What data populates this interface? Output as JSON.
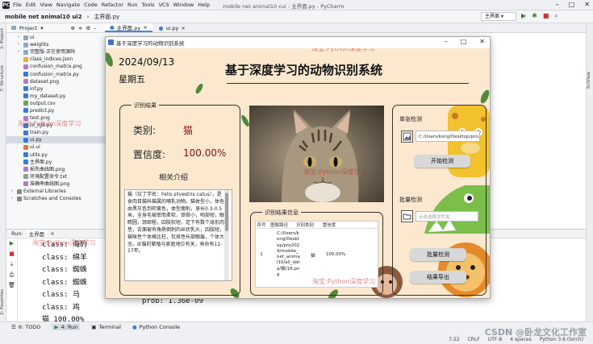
{
  "ide": {
    "menu": [
      "File",
      "Edit",
      "View",
      "Navigate",
      "Code",
      "Refactor",
      "Run",
      "Tools",
      "VCS",
      "Window",
      "Help"
    ],
    "window_title": "mobile net animal10 cui - 主界面.py - PyCharm",
    "breadcrumb": [
      "mobile net animal10 ui2",
      "主界面.py"
    ],
    "run_config": "主界面",
    "project_header": "Project",
    "tree": [
      {
        "label": "ui",
        "type": "folder",
        "indent": 1
      },
      {
        "label": "weights",
        "type": "folder",
        "indent": 1
      },
      {
        "label": "完整版-正在使用源码",
        "type": "folder",
        "indent": 1
      },
      {
        "label": "class_indices.json",
        "type": "json",
        "indent": 1
      },
      {
        "label": "confusion_matrix.png",
        "type": "img",
        "indent": 1
      },
      {
        "label": "confusion_matrix.py",
        "type": "py",
        "indent": 1
      },
      {
        "label": "dataset.png",
        "type": "img",
        "indent": 1
      },
      {
        "label": "inf.py",
        "type": "py",
        "indent": 1
      },
      {
        "label": "my_dataset.py",
        "type": "py",
        "indent": 1
      },
      {
        "label": "output.csv",
        "type": "csv",
        "indent": 1
      },
      {
        "label": "predict.py",
        "type": "py",
        "indent": 1
      },
      {
        "label": "test.png",
        "type": "img",
        "indent": 1
      },
      {
        "label": "to_rgb.py",
        "type": "py",
        "indent": 1
      },
      {
        "label": "train.py",
        "type": "py",
        "indent": 1
      },
      {
        "label": "ui.py",
        "type": "py",
        "indent": 1,
        "selected": true
      },
      {
        "label": "ui.ui",
        "type": "ui",
        "indent": 1
      },
      {
        "label": "utils.py",
        "type": "py",
        "indent": 1
      },
      {
        "label": "主界面.py",
        "type": "py",
        "indent": 1
      },
      {
        "label": "损失曲线图.png",
        "type": "img",
        "indent": 1
      },
      {
        "label": "环境配置命令.txt",
        "type": "txt",
        "indent": 1
      },
      {
        "label": "准确率曲线图.png",
        "type": "img",
        "indent": 1
      },
      {
        "label": "External Libraries",
        "type": "lib",
        "indent": 0
      },
      {
        "label": "Scratches and Consoles",
        "type": "scratch",
        "indent": 0
      }
    ],
    "editor_tabs": [
      "主界面.py",
      "ui.py"
    ],
    "run_tab_label": "Run:",
    "run_tab": "主界面",
    "console_lines": [
      "class: 海豹",
      "class: 绵羊",
      "class: 蜘蛛",
      "class: 蜘蛛",
      "class: 马",
      "class: 鸡",
      "猫 100.00%"
    ],
    "console_prob": "prob: 1.36e-09",
    "bottom_tabs": [
      "6: TODO",
      "4: Run",
      "Terminal",
      "Python Console"
    ],
    "status_right": [
      "7:22",
      "CRLF",
      "UTF-8",
      "4 spaces",
      "Python 3.6 (torch)"
    ],
    "csdn": "CSDN @卧龙文化工作室",
    "left_labels": [
      "1: Project",
      "7: Structure",
      "2: Favorites"
    ],
    "right_labels": [
      "SciView"
    ]
  },
  "app": {
    "title": "基于深度学习的动物识别系统",
    "date": "2024/09/13",
    "weekday": "星期五",
    "main_title": "基于深度学习的动物识别系统",
    "result_group": "识别结果",
    "class_label": "类别:",
    "class_value": "猫",
    "conf_label": "置信度:",
    "conf_value": "100.00%",
    "related_title": "相关介绍",
    "description": "猫（拉丁学名：Felis silvestris catus），是食肉目猫科猫属的哺乳动物。猫体型小，体色由黑灰色到棕黄色，体型瘦削，身长0.3-0.5米，全身毛被密而柔软，锁骨小，吻部短，眼睛圆，颈部粗，四肢较短，足下有数个球形肉垫，舌面被有角质倒刺的丝状乳头，四肢短，猫咪性个体格比柱，仅择性长部眼眉，个体大坐。IE猫的繁殖与家庭地位有关，寿命有12-17年。",
    "table_group": "识别结果信息",
    "table_headers": [
      "序号",
      "图像路径",
      "识别类别",
      "置信度"
    ],
    "table_row": {
      "idx": "1",
      "path": "C:/Users/kong/Desktop/pro2024/mobile_net_animal10/all_data/猫/18.png",
      "cls": "猫",
      "conf": "100.00%"
    },
    "single_title": "单张检测",
    "single_path": "C:/Users/kong/Desktop/pro2024/mobile_net_animal10/all_data/猫/18.png",
    "btn_start": "开始检测",
    "batch_title": "批量检测",
    "batch_placeholder": "点击选择文件夹",
    "btn_batch": "批量检测",
    "btn_export": "结果导出",
    "watermark": "淘宝:Python深度学习"
  }
}
